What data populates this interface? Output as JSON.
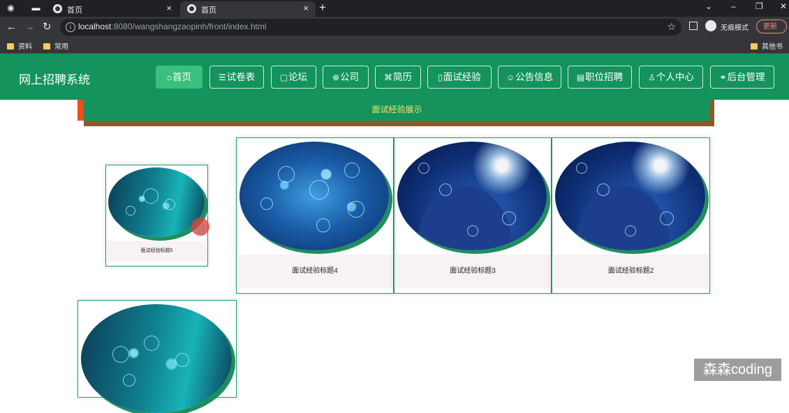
{
  "browser": {
    "tabs": [
      {
        "label": "首页",
        "active": false
      },
      {
        "label": "首页",
        "active": true
      }
    ],
    "new_tab_symbol": "+",
    "close_symbol": "×",
    "url_host": "localhost",
    "url_rest": ":8080/wangshangzaopinh/front/index.html",
    "incognito_label": "无痕模式",
    "update_label": "更新",
    "bookmarks": [
      "资料",
      "常用"
    ],
    "other_bookmarks": "其他书签",
    "icons": [
      "back-icon",
      "forward-icon",
      "reload-icon",
      "info-icon",
      "star-icon",
      "sidebar-icon",
      "avatar-icon",
      "menu-icon"
    ]
  },
  "site": {
    "title": "网上招聘系统",
    "nav": [
      {
        "icon": "⌂",
        "label": "首页",
        "active": true
      },
      {
        "icon": "☰",
        "label": "试卷表",
        "active": false
      },
      {
        "icon": "▢",
        "label": "论坛",
        "active": false
      },
      {
        "icon": "⊕",
        "label": "公司",
        "active": false
      },
      {
        "icon": "⌘",
        "label": "简历",
        "active": false
      },
      {
        "icon": "▯",
        "label": "面试经验",
        "active": false
      },
      {
        "icon": "☺",
        "label": "公告信息",
        "active": false
      },
      {
        "icon": "▤",
        "label": "职位招聘",
        "active": false
      },
      {
        "icon": "♙",
        "label": "个人中心",
        "active": false
      },
      {
        "icon": "⚭",
        "label": "后台管理",
        "active": false
      }
    ]
  },
  "banner": {
    "text": "面试经验展示"
  },
  "cards": [
    {
      "caption": "面试经验标题5"
    },
    {
      "caption": "面试经验标题4"
    },
    {
      "caption": "面试经验标题3"
    },
    {
      "caption": "面试经验标题2"
    },
    {
      "caption": ""
    }
  ],
  "colors": {
    "header_green": "#14935c",
    "active_nav": "#3bbf7e",
    "banner_text": "#f5e66a",
    "accent_orange": "#f04c1c",
    "banner_shadow": "#8b5a2b"
  },
  "watermark": "森森coding"
}
